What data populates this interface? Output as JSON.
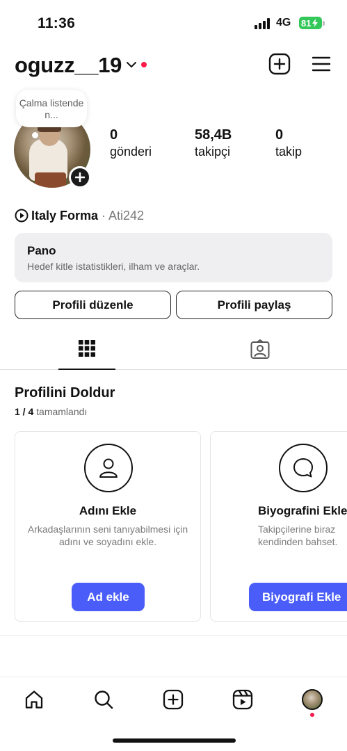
{
  "status_bar": {
    "time": "11:36",
    "network": "4G",
    "battery": "81"
  },
  "header": {
    "username": "oguzz__19"
  },
  "profile": {
    "note": "Çalma listende n...",
    "stats": [
      {
        "value": "0",
        "label": "gönderi"
      },
      {
        "value": "58,4B",
        "label": "takipçi"
      },
      {
        "value": "0",
        "label": "takip"
      }
    ],
    "music": {
      "song": "Italy Forma",
      "separator": "·",
      "artist": "Ati242"
    }
  },
  "dashboard": {
    "title": "Pano",
    "subtitle": "Hedef kitle istatistikleri, ilham ve araçlar."
  },
  "buttons": {
    "edit_profile": "Profili düzenle",
    "share_profile": "Profili paylaş"
  },
  "tabs": [
    {
      "icon": "grid-icon",
      "active": true
    },
    {
      "icon": "tagged-icon",
      "active": false
    }
  ],
  "complete_profile": {
    "title": "Profilini Doldur",
    "progress_done": "1 / 4",
    "progress_label": "tamamlandı",
    "cards": [
      {
        "icon": "user-icon",
        "title": "Adını Ekle",
        "description": "Arkadaşlarının seni tanıyabilmesi için adını ve soyadını ekle.",
        "button": "Ad ekle"
      },
      {
        "icon": "chat-bubble-icon",
        "title": "Biyografini Ekle",
        "description": "Takipçilerine biraz kendinden bahset.",
        "button": "Biyografi Ekle"
      }
    ]
  },
  "bottom_nav": [
    {
      "icon": "home-icon"
    },
    {
      "icon": "search-icon"
    },
    {
      "icon": "create-icon"
    },
    {
      "icon": "reels-icon"
    },
    {
      "icon": "profile-avatar"
    }
  ],
  "colors": {
    "accent": "#4a5df9",
    "notification": "#ff1a4b",
    "battery": "#34c759"
  }
}
